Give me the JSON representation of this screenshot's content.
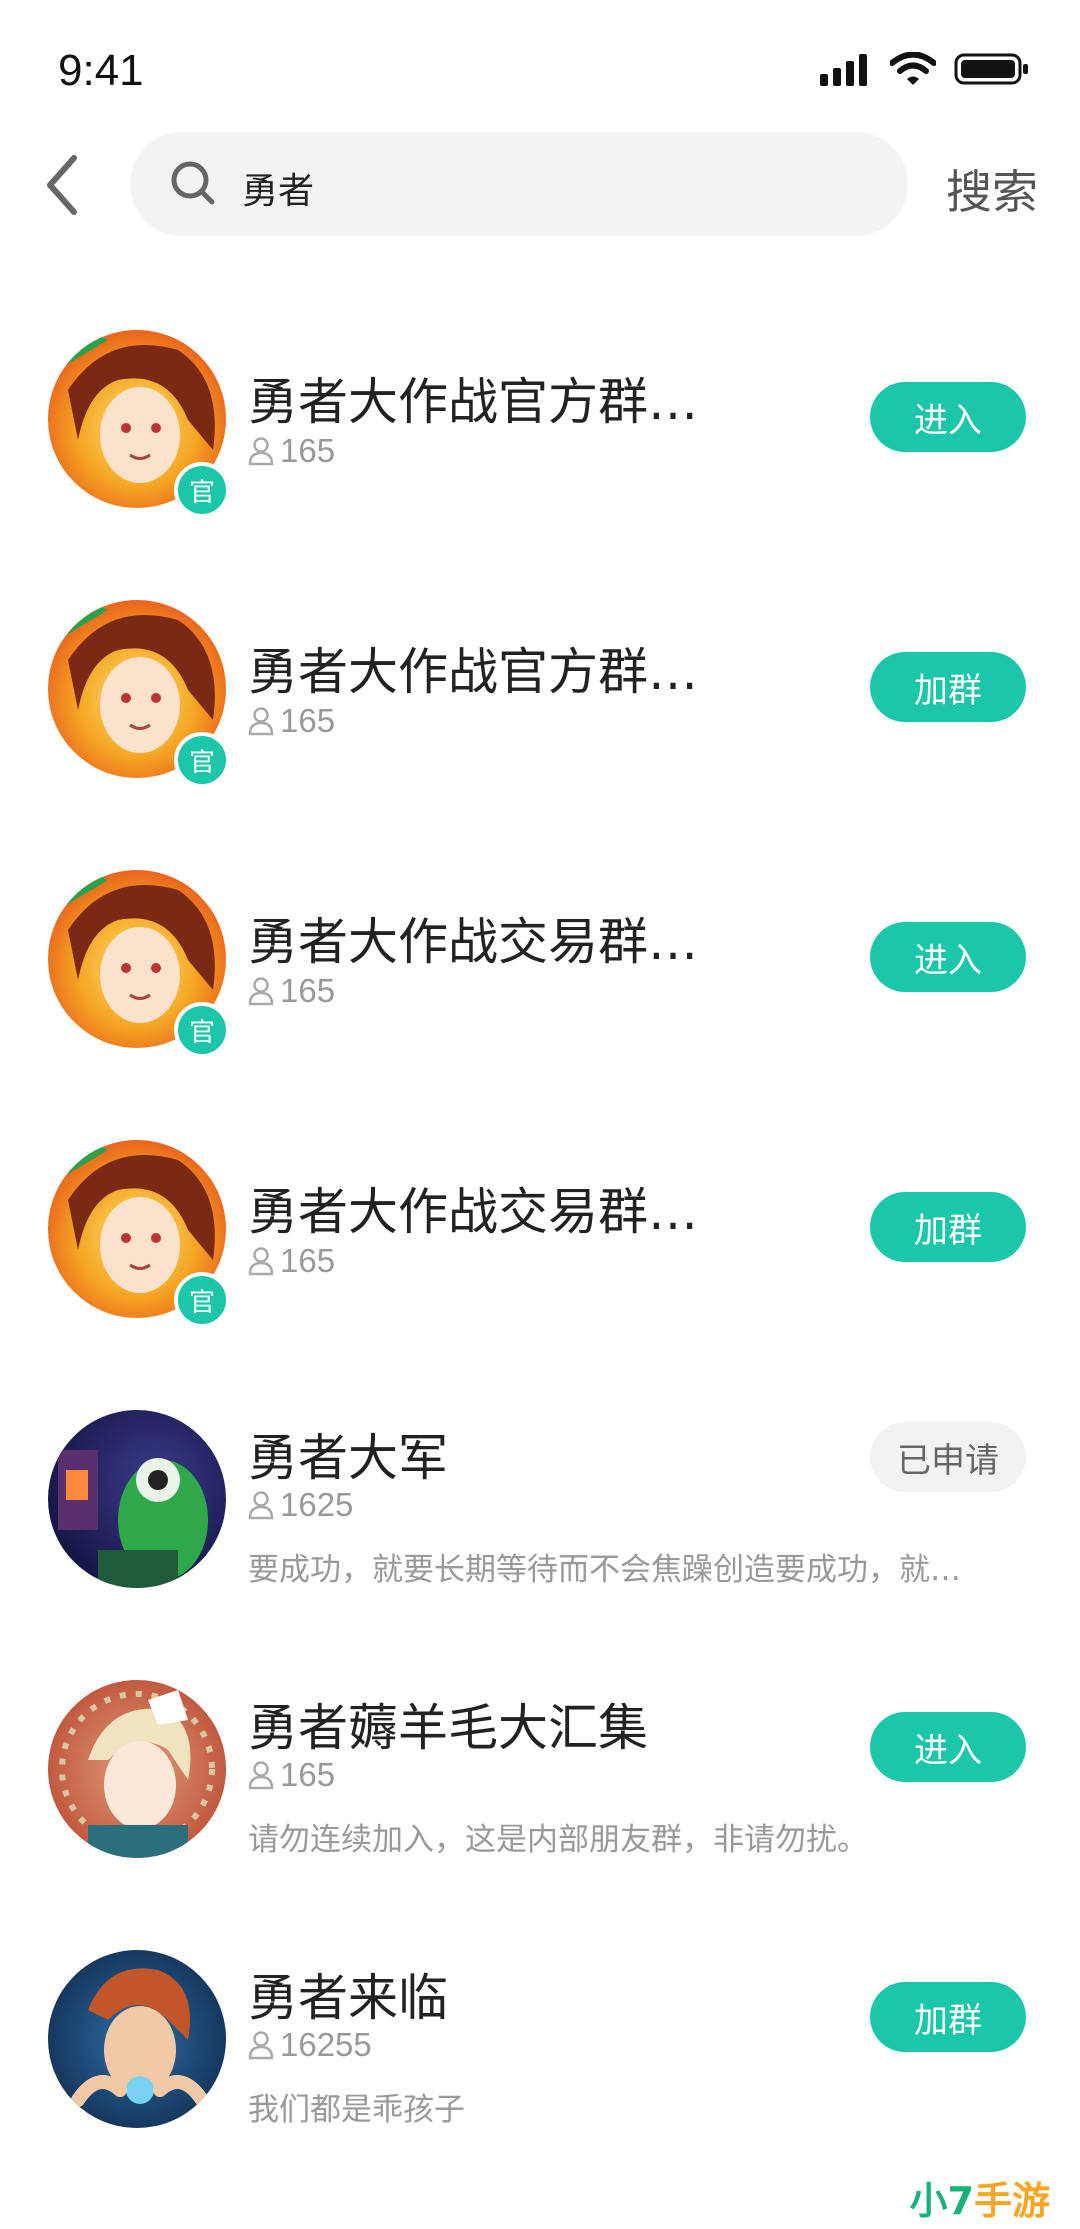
{
  "status_bar": {
    "time": "9:41"
  },
  "header": {
    "search_query": "勇者",
    "search_button": "搜索"
  },
  "groups": [
    {
      "name": "勇者大作战官方群…",
      "members": "165",
      "description": "",
      "badge": "官",
      "action": "进入",
      "applied": false
    },
    {
      "name": "勇者大作战官方群…",
      "members": "165",
      "description": "",
      "badge": "官",
      "action": "加群",
      "applied": false
    },
    {
      "name": "勇者大作战交易群…",
      "members": "165",
      "description": "",
      "badge": "官",
      "action": "进入",
      "applied": false
    },
    {
      "name": "勇者大作战交易群…",
      "members": "165",
      "description": "",
      "badge": "官",
      "action": "加群",
      "applied": false
    },
    {
      "name": "勇者大军",
      "members": "1625",
      "description": "要成功，就要长期等待而不会焦躁创造要成功，就…",
      "badge": "",
      "action": "已申请",
      "applied": true
    },
    {
      "name": "勇者薅羊毛大汇集",
      "members": "165",
      "description": "请勿连续加入，这是内部朋友群，非请勿扰。",
      "badge": "",
      "action": "进入",
      "applied": false
    },
    {
      "name": "勇者来临",
      "members": "16255",
      "description": "我们都是乖孩子",
      "badge": "",
      "action": "加群",
      "applied": false
    }
  ],
  "watermark": {
    "part1": "小7",
    "part2": "手游"
  },
  "colors": {
    "accent": "#1cc6a8",
    "applied_bg": "#f2f2f2"
  }
}
